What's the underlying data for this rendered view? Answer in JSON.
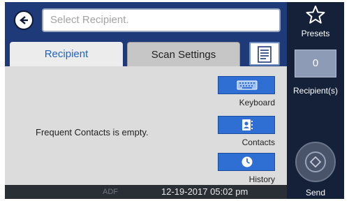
{
  "search": {
    "placeholder": "Select Recipient."
  },
  "tabs": [
    {
      "label": "Recipient",
      "active": true
    },
    {
      "label": "Scan Settings",
      "active": false
    }
  ],
  "content": {
    "empty_message": "Frequent Contacts is empty.",
    "side_buttons": [
      {
        "label": "Keyboard",
        "icon": "keyboard-icon"
      },
      {
        "label": "Contacts",
        "icon": "contacts-icon"
      },
      {
        "label": "History",
        "icon": "clock-icon"
      }
    ]
  },
  "status": {
    "source": "ADF",
    "datetime": "12-19-2017 05:02 pm"
  },
  "right_panel": {
    "presets_label": "Presets",
    "recipient_count": "0",
    "recipient_label": "Recipient(s)",
    "send_label": "Send"
  },
  "colors": {
    "accent": "#2f6fd4",
    "nav": "#1e3a78",
    "panel": "#152039"
  }
}
